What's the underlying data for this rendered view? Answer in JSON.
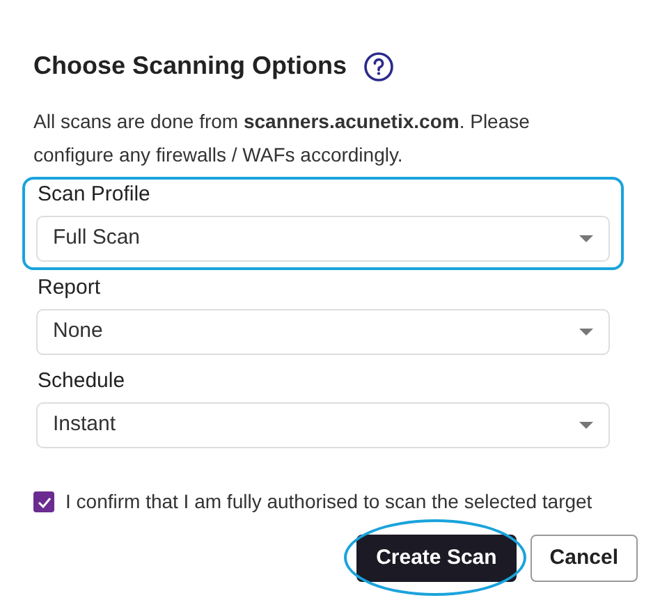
{
  "title": "Choose Scanning Options",
  "description": "All scans are done from **scanners.acunetix.com**. Please configure any firewalls / WAFs accordingly.",
  "fields": [
    {
      "label": "Scan Profile",
      "value": "Full Scan",
      "highlighted": true
    },
    {
      "label": "Report",
      "value": "None",
      "highlighted": false
    },
    {
      "label": "Schedule",
      "value": "Instant",
      "highlighted": false
    }
  ],
  "confirm": {
    "label": "I confirm that I am fully authorised to scan the selected target",
    "checked": true
  },
  "buttons": [
    {
      "label": "Create Scan",
      "kind": "primary",
      "highlighted": true
    },
    {
      "label": "Cancel",
      "kind": "secondary",
      "highlighted": false
    }
  ]
}
